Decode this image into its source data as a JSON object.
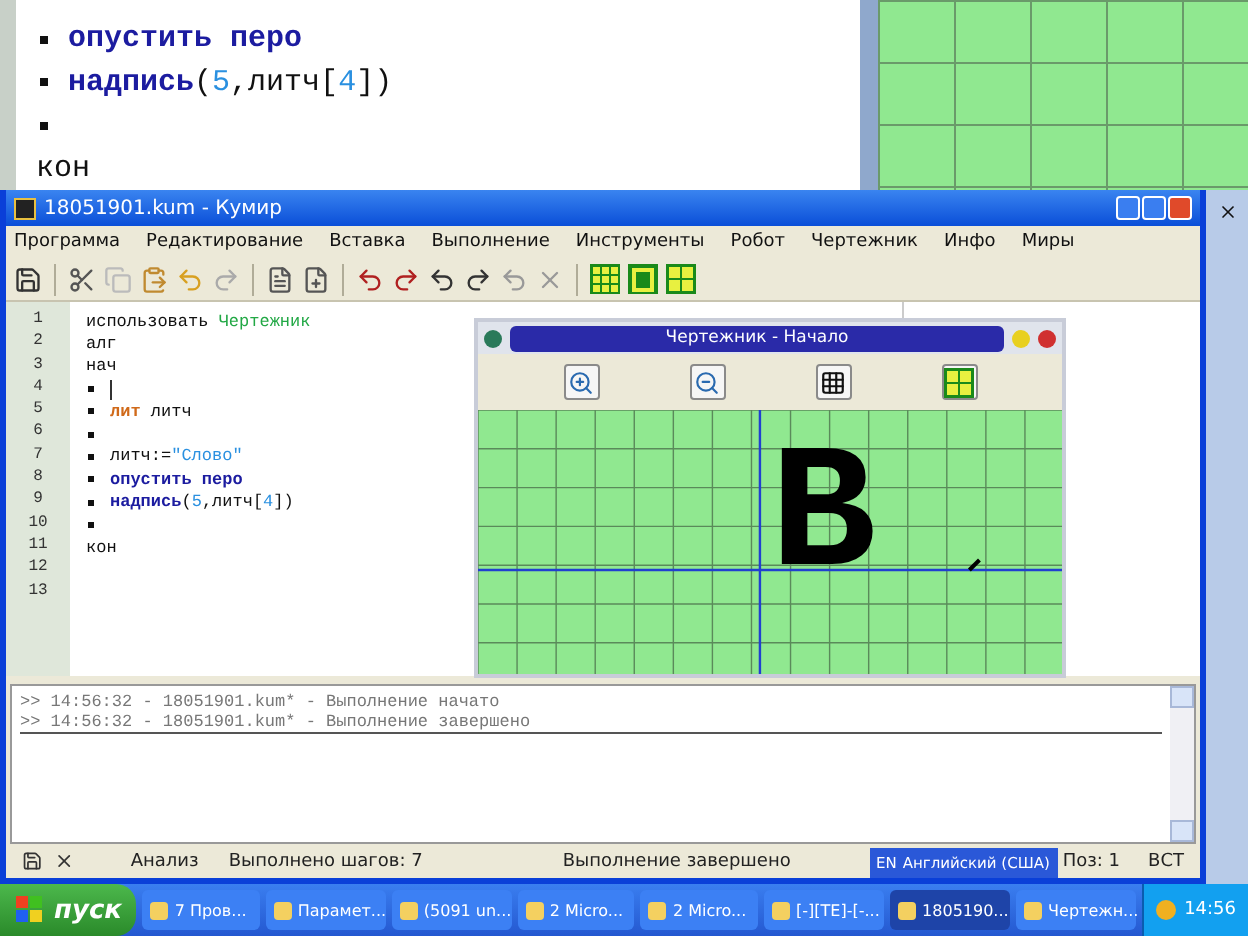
{
  "background_editor": {
    "lines": [
      {
        "bullet": true,
        "tokens": [
          {
            "kind": "keyword",
            "text": "опустить перо"
          }
        ]
      },
      {
        "bullet": true,
        "tokens": [
          {
            "kind": "keyword",
            "text": "надпись"
          },
          {
            "kind": "plain",
            "text": "("
          },
          {
            "kind": "number",
            "text": "5"
          },
          {
            "kind": "plain",
            "text": ",литч["
          },
          {
            "kind": "number",
            "text": "4"
          },
          {
            "kind": "plain",
            "text": "])"
          }
        ]
      },
      {
        "bullet": true
      },
      {
        "bullet": false,
        "tokens": [
          {
            "kind": "plain",
            "text": "кон"
          }
        ]
      }
    ]
  },
  "window": {
    "title": "18051901.kum - Кумир"
  },
  "menu": [
    "Программа",
    "Редактирование",
    "Вставка",
    "Выполнение",
    "Инструменты",
    "Робот",
    "Чертежник",
    "Инфо",
    "Миры"
  ],
  "editor": {
    "lines": [
      {
        "number": "1",
        "bullet": false,
        "cursor": false,
        "tokens": [
          {
            "kind": "plain",
            "text": "использовать "
          },
          {
            "kind": "module",
            "text": "Чертежник"
          }
        ]
      },
      {
        "number": "2",
        "bullet": false,
        "cursor": false,
        "tokens": [
          {
            "kind": "plain",
            "text": "алг"
          }
        ]
      },
      {
        "number": "3",
        "bullet": false,
        "cursor": false,
        "tokens": [
          {
            "kind": "plain",
            "text": "нач"
          }
        ]
      },
      {
        "number": "4",
        "bullet": true,
        "cursor": true
      },
      {
        "number": "5",
        "bullet": true,
        "cursor": false,
        "tokens": [
          {
            "kind": "type",
            "text": "лит"
          },
          {
            "kind": "plain",
            "text": " литч"
          }
        ]
      },
      {
        "number": "6",
        "bullet": true,
        "cursor": false
      },
      {
        "number": "7",
        "bullet": true,
        "cursor": false,
        "tokens": [
          {
            "kind": "plain",
            "text": "литч:="
          },
          {
            "kind": "string",
            "text": "\"Слово\""
          }
        ]
      },
      {
        "number": "8",
        "bullet": true,
        "cursor": false,
        "tokens": [
          {
            "kind": "keyword",
            "text": "опустить перо"
          }
        ]
      },
      {
        "number": "9",
        "bullet": true,
        "cursor": false,
        "tokens": [
          {
            "kind": "keyword",
            "text": "надпись"
          },
          {
            "kind": "plain",
            "text": "("
          },
          {
            "kind": "number",
            "text": "5"
          },
          {
            "kind": "plain",
            "text": ",литч["
          },
          {
            "kind": "number",
            "text": "4"
          },
          {
            "kind": "plain",
            "text": "])"
          }
        ]
      },
      {
        "number": "10",
        "bullet": true,
        "cursor": false
      },
      {
        "number": "11",
        "bullet": false,
        "cursor": false,
        "tokens": [
          {
            "kind": "plain",
            "text": "кон"
          }
        ]
      },
      {
        "number": "12",
        "bullet": false,
        "cursor": false
      },
      {
        "number": "13",
        "bullet": false,
        "cursor": false
      }
    ]
  },
  "drawer_window": {
    "title": "Чертежник - Начало",
    "drawn_text": "В"
  },
  "log": [
    ">> 14:56:32 - 18051901.kum* - Выполнение начато",
    ">> 14:56:32 - 18051901.kum* - Выполнение завершено"
  ],
  "status_bar": {
    "mode": "Анализ",
    "steps": "Выполнено шагов: 7",
    "state": "Выполнение завершено",
    "position": "Поз: 1",
    "insert_mode": "ВСТ"
  },
  "language_bar": {
    "code": "EN",
    "label": "Английский (США)"
  },
  "taskbar": {
    "start": "пуск",
    "items": [
      {
        "label": "7 Пров...",
        "selected": false
      },
      {
        "label": "Парамет...",
        "selected": false
      },
      {
        "label": "(5091 un...",
        "selected": false
      },
      {
        "label": "2 Micro...",
        "selected": false
      },
      {
        "label": "2 Micro...",
        "selected": false
      },
      {
        "label": "[-][TE]-[-...",
        "selected": false
      },
      {
        "label": "1805190...",
        "selected": true
      },
      {
        "label": "Чертежн...",
        "selected": false
      }
    ],
    "clock": "14:56"
  }
}
